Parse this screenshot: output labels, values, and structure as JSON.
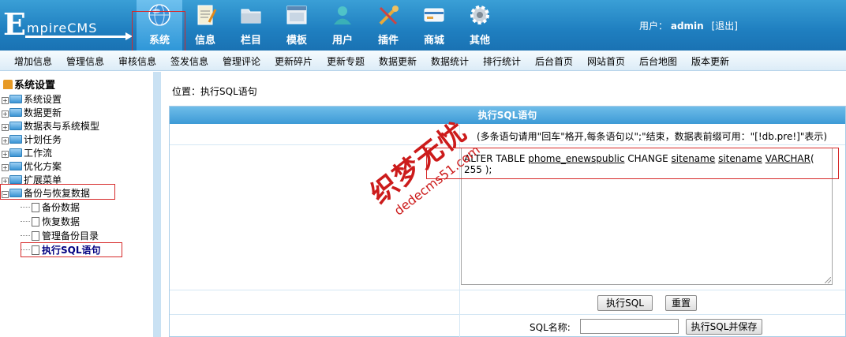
{
  "header": {
    "logo_initial": "E",
    "logo_rest": "mpireCMS",
    "tabs": [
      {
        "label": "系统",
        "icon": "globe-icon",
        "active": true
      },
      {
        "label": "信息",
        "icon": "notepad-icon",
        "active": false
      },
      {
        "label": "栏目",
        "icon": "folder-icon",
        "active": false
      },
      {
        "label": "模板",
        "icon": "window-icon",
        "active": false
      },
      {
        "label": "用户",
        "icon": "user-icon",
        "active": false
      },
      {
        "label": "插件",
        "icon": "tools-icon",
        "active": false
      },
      {
        "label": "商城",
        "icon": "card-icon",
        "active": false
      },
      {
        "label": "其他",
        "icon": "gear-icon",
        "active": false
      }
    ],
    "user_label": "用户：",
    "username": "admin",
    "logout": "[退出]"
  },
  "submenu": [
    "增加信息",
    "管理信息",
    "审核信息",
    "签发信息",
    "管理评论",
    "更新碎片",
    "更新专题",
    "数据更新",
    "数据统计",
    "排行统计",
    "后台首页",
    "网站首页",
    "后台地图",
    "版本更新"
  ],
  "tree": {
    "root": "系统设置",
    "nodes": [
      "系统设置",
      "数据更新",
      "数据表与系统模型",
      "计划任务",
      "工作流",
      "优化方案",
      "扩展菜单",
      "备份与恢复数据"
    ],
    "children": [
      "备份数据",
      "恢复数据",
      "管理备份目录",
      "执行SQL语句"
    ]
  },
  "main": {
    "location_label": "位置：",
    "location_link": "执行SQL语句",
    "panel_title": "执行SQL语句",
    "hint": "(多条语句请用\"回车\"格开,每条语句以\";\"结束，数据表前缀可用：\"[!db.pre!]\"表示)",
    "sql": {
      "p1": "ALTER TABLE ",
      "u1": "phome_enewspublic",
      "p2": " CHANGE ",
      "u2": "sitename",
      "p3": " ",
      "u3": "sitename",
      "p4": " ",
      "u4": "VARCHAR",
      "p5": "( 255 );"
    },
    "execute_button": "执行SQL",
    "reset_button": "重置",
    "sql_name_label": "SQL名称:",
    "sql_name_value": "",
    "execute_save_button": "执行SQL并保存"
  },
  "watermark": {
    "cn": "织梦无忧",
    "en": "dedecms51.com"
  },
  "colors": {
    "header": "#2384c6",
    "accent_red": "#d62a2a",
    "panel_head": "#4aa6dc"
  }
}
